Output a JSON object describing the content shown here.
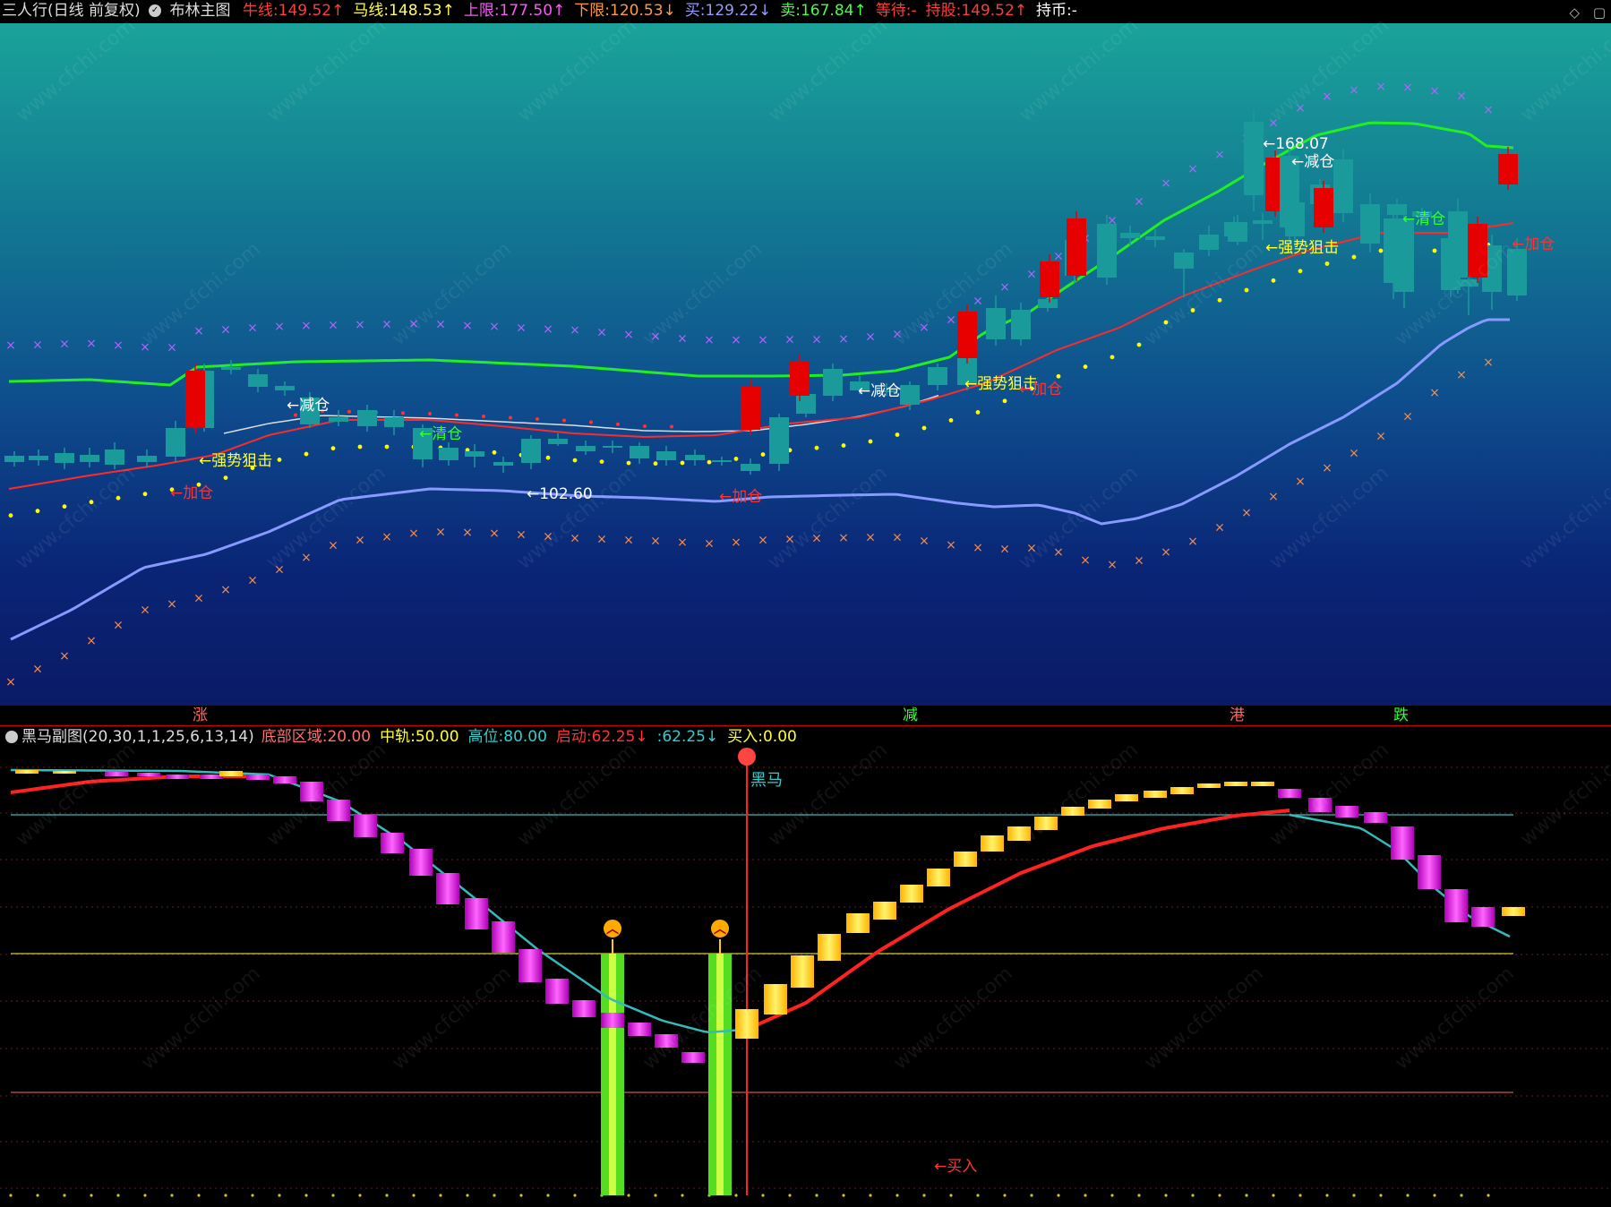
{
  "topbar": {
    "title": "三人行(日线 前复权)",
    "indicator": "布林主图",
    "items": [
      {
        "label": "牛线:",
        "value": "149.52",
        "arrow": "↑",
        "color": "#ff3b3b"
      },
      {
        "label": "马线:",
        "value": "148.53",
        "arrow": "↑",
        "color": "#ffff55"
      },
      {
        "label": "上限:",
        "value": "177.50",
        "arrow": "↑",
        "color": "#ff55ff"
      },
      {
        "label": "下限:",
        "value": "120.53",
        "arrow": "↓",
        "color": "#ff9944"
      },
      {
        "label": "买:",
        "value": "129.22",
        "arrow": "↓",
        "color": "#9999ff"
      },
      {
        "label": "卖:",
        "value": "167.84",
        "arrow": "↑",
        "color": "#44ff44"
      },
      {
        "label": "等待:",
        "value": "-",
        "arrow": "",
        "color": "#ff3b3b"
      },
      {
        "label": "持股:",
        "value": "149.52",
        "arrow": "↑",
        "color": "#ff3b3b"
      },
      {
        "label": "持币:",
        "value": "-",
        "arrow": "",
        "color": "#ffffff"
      }
    ],
    "window_controls": [
      "◇",
      "▢"
    ]
  },
  "main_chart": {
    "annotations": [
      {
        "text": "←强势狙击",
        "color": "#ffff33"
      },
      {
        "text": "←加仓",
        "color": "#ff3333"
      },
      {
        "text": "←减仓",
        "color": "#ffffff"
      },
      {
        "text": "←清仓",
        "color": "#33ff33"
      },
      {
        "text": "←102.60",
        "color": "#ffffff"
      },
      {
        "text": "←加仓",
        "color": "#ff3333"
      },
      {
        "text": "←减仓",
        "color": "#ffffff"
      },
      {
        "text": "←强势狙击",
        "color": "#ffff33"
      },
      {
        "text": "←加仓",
        "color": "#ff3333"
      },
      {
        "text": "←168.07",
        "color": "#ffffff"
      },
      {
        "text": "←减仓",
        "color": "#ffffff"
      },
      {
        "text": "←强势狙击",
        "color": "#ffff33"
      },
      {
        "text": "←清仓",
        "color": "#33ff33"
      },
      {
        "text": "←加仓",
        "color": "#ff3333"
      }
    ],
    "watermark": "www.cfchi.com"
  },
  "divider_marks": [
    {
      "text": "涨",
      "color": "#ff6666"
    },
    {
      "text": "减",
      "color": "#33ff33"
    },
    {
      "text": "港",
      "color": "#ff6666"
    },
    {
      "text": "跌",
      "color": "#33ff33"
    }
  ],
  "subbar": {
    "title": "黑马副图(20,30,1,1,25,6,13,14)",
    "items": [
      {
        "label": "底部区域:",
        "value": "20.00",
        "arrow": "",
        "color": "#ff7070"
      },
      {
        "label": "中轨:",
        "value": "50.00",
        "arrow": "",
        "color": "#ffff33"
      },
      {
        "label": "高位:",
        "value": "80.00",
        "arrow": "",
        "color": "#33cccc"
      },
      {
        "label": "启动:",
        "value": "62.25",
        "arrow": "↓",
        "color": "#ff3333"
      },
      {
        "label": ":",
        "value": "62.25",
        "arrow": "↓",
        "color": "#33cccc"
      },
      {
        "label": "买入:",
        "value": "0.00",
        "arrow": "",
        "color": "#ffff33"
      }
    ]
  },
  "sub_chart": {
    "label_heima": "黑马",
    "label_buy": "←买入"
  },
  "colors": {
    "up_candle": "#e60000",
    "down_candle": "#1a9a9a",
    "upper_band": "#22ee22",
    "lower_band": "#8899ff",
    "mid_band": "#dddddd",
    "bull_line": "#ff2a2a",
    "bull_signal": "#ffff00",
    "bar_gold": "#ffcc00",
    "bar_purple": "#cc00cc",
    "signal_curve": "#33bbbb",
    "start_curve": "#ff2222"
  }
}
